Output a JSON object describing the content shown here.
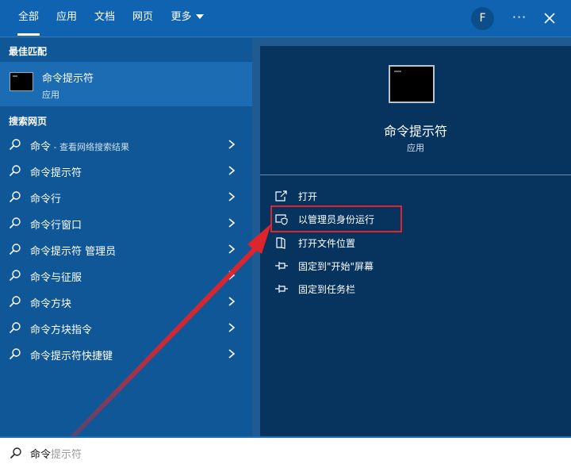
{
  "tabs": [
    {
      "label": "全部",
      "active": true
    },
    {
      "label": "应用",
      "active": false
    },
    {
      "label": "文档",
      "active": false
    },
    {
      "label": "网页",
      "active": false
    },
    {
      "label": "更多",
      "active": false
    }
  ],
  "avatar_letter": "F",
  "more_label": "···",
  "left": {
    "best_match_title": "最佳匹配",
    "best_match_name": "命令提示符",
    "best_match_type": "应用",
    "web_section_title": "搜索网页",
    "results": [
      {
        "main": "命令",
        "suffix": " - 查看网络搜索结果"
      },
      {
        "main": "命令提示符",
        "suffix": ""
      },
      {
        "main": "命令行",
        "suffix": ""
      },
      {
        "main": "命令行窗口",
        "suffix": ""
      },
      {
        "main": "命令提示符 管理员",
        "suffix": ""
      },
      {
        "main": "命令与征服",
        "suffix": ""
      },
      {
        "main": "命令方块",
        "suffix": ""
      },
      {
        "main": "命令方块指令",
        "suffix": ""
      },
      {
        "main": "命令提示符快捷键",
        "suffix": ""
      }
    ]
  },
  "right": {
    "app_name": "命令提示符",
    "app_type": "应用",
    "actions": [
      {
        "label": "打开",
        "icon": "open-icon"
      },
      {
        "label": "以管理员身份运行",
        "icon": "shield-icon"
      },
      {
        "label": "打开文件位置",
        "icon": "folder-icon"
      },
      {
        "label": "固定到\"开始\"屏幕",
        "icon": "pin-icon"
      },
      {
        "label": "固定到任务栏",
        "icon": "pin-icon"
      }
    ]
  },
  "search": {
    "typed": "命令",
    "suggestion": "提示符"
  },
  "colors": {
    "highlight": "#e0242b",
    "accent": "#0f63b0"
  }
}
